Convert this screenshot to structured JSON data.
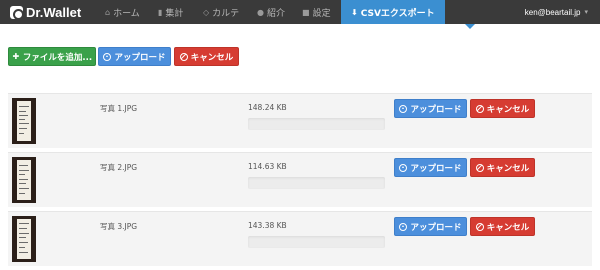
{
  "navbar": {
    "brand": "Dr.Wallet",
    "items": [
      {
        "label": "ホーム",
        "icon": "home-icon"
      },
      {
        "label": "集計",
        "icon": "bar-chart-icon"
      },
      {
        "label": "カルテ",
        "icon": "tag-icon"
      },
      {
        "label": "紹介",
        "icon": "info-icon"
      },
      {
        "label": "設定",
        "icon": "gear-icon"
      },
      {
        "label": "CSVエクスポート",
        "icon": "download-icon",
        "active": true
      }
    ],
    "user": "ken@beartail.jp"
  },
  "toolbar": {
    "add_label": "ファイルを追加...",
    "upload_label": "アップロード",
    "cancel_label": "キャンセル"
  },
  "files": [
    {
      "name": "写真 1.JPG",
      "size": "148.24 KB",
      "progress": 0,
      "upload_label": "アップロード",
      "cancel_label": "キャンセル"
    },
    {
      "name": "写真 2.JPG",
      "size": "114.63 KB",
      "progress": 0,
      "upload_label": "アップロード",
      "cancel_label": "キャンセル"
    },
    {
      "name": "写真 3.JPG",
      "size": "143.38 KB",
      "progress": 0,
      "upload_label": "アップロード",
      "cancel_label": "キャンセル"
    }
  ],
  "colors": {
    "navbar": "#3a3a3a",
    "active": "#3b8fd1",
    "green": "#3aa14a",
    "blue": "#4c8fdc",
    "red": "#d63c32"
  }
}
